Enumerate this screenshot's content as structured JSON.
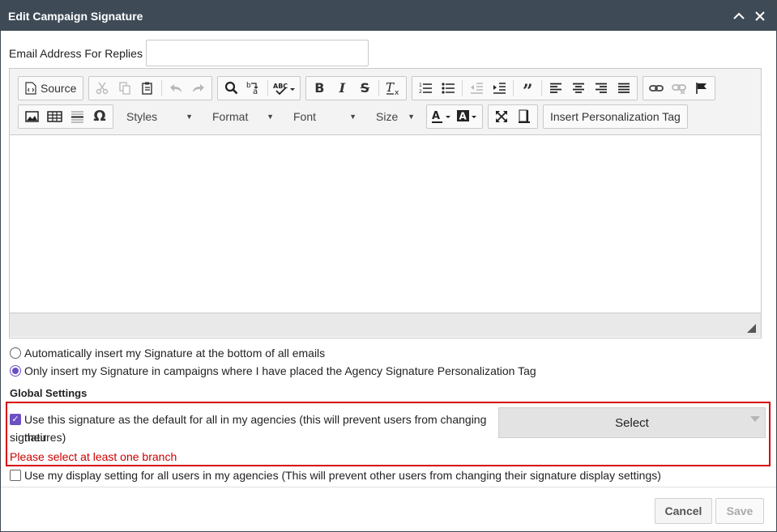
{
  "dialog": {
    "title": "Edit Campaign Signature",
    "collapse_icon": "chevron-up-icon",
    "close_icon": "close-icon"
  },
  "email": {
    "label": "Email Address For Replies",
    "value": "",
    "placeholder": ""
  },
  "toolbar": {
    "source_label": "Source",
    "styles_label": "Styles",
    "format_label": "Format",
    "font_label": "Font",
    "size_label": "Size",
    "personalization_label": "Insert Personalization Tag",
    "icons": {
      "source": "source-icon",
      "cut": "cut-icon",
      "copy": "copy-icon",
      "paste": "paste-icon",
      "undo": "undo-icon",
      "redo": "redo-icon",
      "find": "search-icon",
      "replace": "replace-icon",
      "spellcheck": "spellcheck-icon",
      "bold": "bold-icon",
      "italic": "italic-icon",
      "strike": "strikethrough-icon",
      "clear_format": "clear-format-icon",
      "numbered_list": "numbered-list-icon",
      "bulleted_list": "bulleted-list-icon",
      "outdent": "outdent-icon",
      "indent": "indent-icon",
      "blockquote": "blockquote-icon",
      "align_left": "align-left-icon",
      "align_center": "align-center-icon",
      "align_right": "align-right-icon",
      "justify": "justify-icon",
      "link": "link-icon",
      "unlink": "unlink-icon",
      "anchor": "anchor-flag-icon",
      "image": "image-icon",
      "table": "table-icon",
      "horizontal_line": "horizontal-line-icon",
      "special_char": "omega-icon",
      "text_color": "text-color-icon",
      "bg_color": "background-color-icon",
      "maximize": "maximize-icon",
      "show_blocks": "show-blocks-icon"
    }
  },
  "options": {
    "radio_auto": {
      "label": "Automatically insert my Signature at the bottom of all emails",
      "checked": false
    },
    "radio_only": {
      "label": "Only insert my Signature in campaigns where I have placed the Agency Signature Personalization Tag",
      "checked": true
    }
  },
  "global": {
    "title": "Global Settings",
    "default_line1": "Use this signature as the default for all in my agencies (this will prevent users from changing their",
    "default_line2": "signatures)",
    "default_checked": true,
    "select_label": "Select",
    "error": "Please select at least one branch",
    "display_label": "Use my display setting for all users in my agencies (This will prevent other users from changing their signature display settings)",
    "display_checked": false
  },
  "footer": {
    "cancel_label": "Cancel",
    "save_label": "Save"
  },
  "colors": {
    "titlebar": "#3e4b57",
    "accent": "#6c4fc2",
    "error": "#cc0000"
  }
}
